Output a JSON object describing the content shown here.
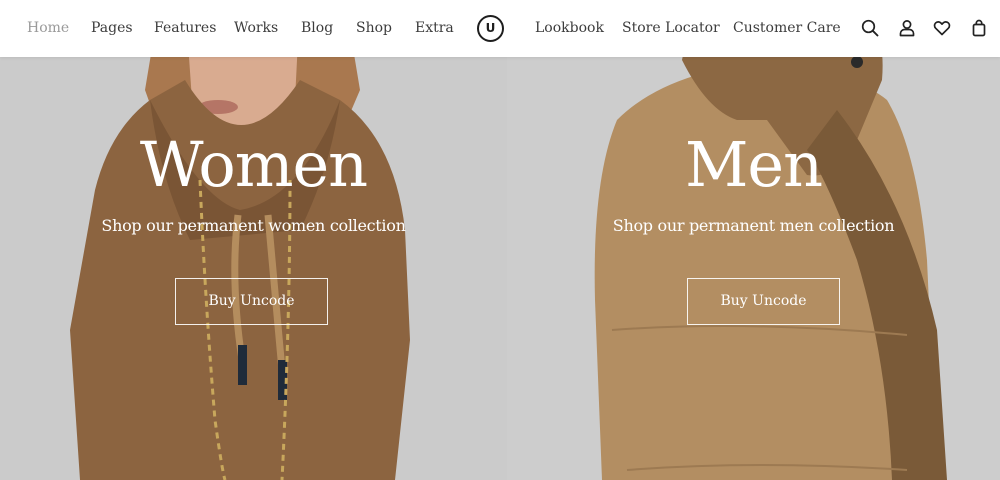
{
  "nav": {
    "left_items": [
      "Home",
      "Pages",
      "Features",
      "Works",
      "Blog",
      "Shop",
      "Extra"
    ],
    "logo_letter": "U",
    "right_items": [
      "Lookbook",
      "Store Locator",
      "Customer Care"
    ],
    "icons": [
      "search-icon",
      "user-icon",
      "heart-icon",
      "bag-icon"
    ]
  },
  "panels": {
    "women": {
      "title": "Women",
      "subtitle": "Shop our permanent women collection",
      "button": "Buy Uncode"
    },
    "men": {
      "title": "Men",
      "subtitle": "Shop our permanent men collection",
      "button": "Buy Uncode"
    }
  },
  "colors": {
    "background": "#c9c9c9",
    "hoodie_women": "#8c6440",
    "hoodie_men": "#b38e62",
    "text": "#ffffff",
    "nav_text": "#3c3c3c",
    "nav_active": "#9a9a9a"
  }
}
